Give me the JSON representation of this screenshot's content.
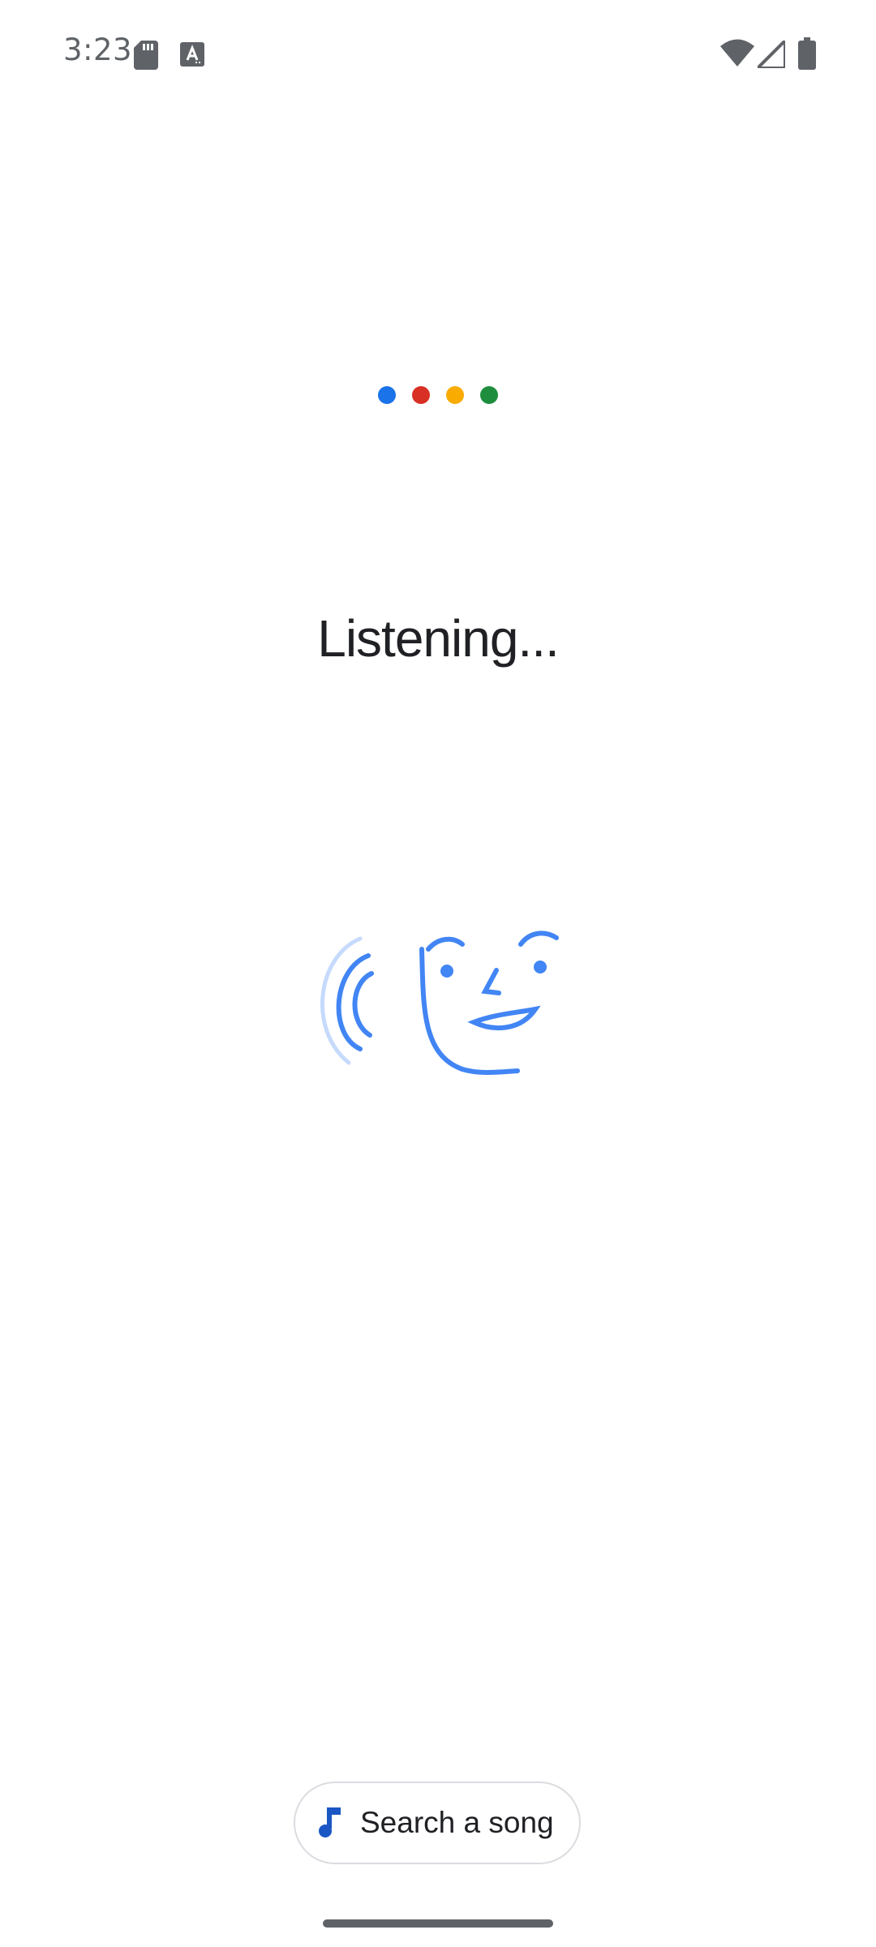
{
  "status_bar": {
    "time": "3:23",
    "icons": [
      "sd-card-icon",
      "text-a-icon",
      "wifi-icon",
      "cell-signal-icon",
      "battery-icon"
    ]
  },
  "google_dots": {
    "colors": [
      "#1a73e8",
      "#d93025",
      "#f9ab00",
      "#1e8e3e"
    ]
  },
  "main": {
    "title": "Listening..."
  },
  "illustration": {
    "icon": "hum-to-search-face-icon",
    "stroke_color": "#4285f4",
    "faded_color": "#c6dafc"
  },
  "search_chip": {
    "icon": "music-note-icon",
    "label": "Search a song",
    "icon_color": "#1a56c4"
  }
}
